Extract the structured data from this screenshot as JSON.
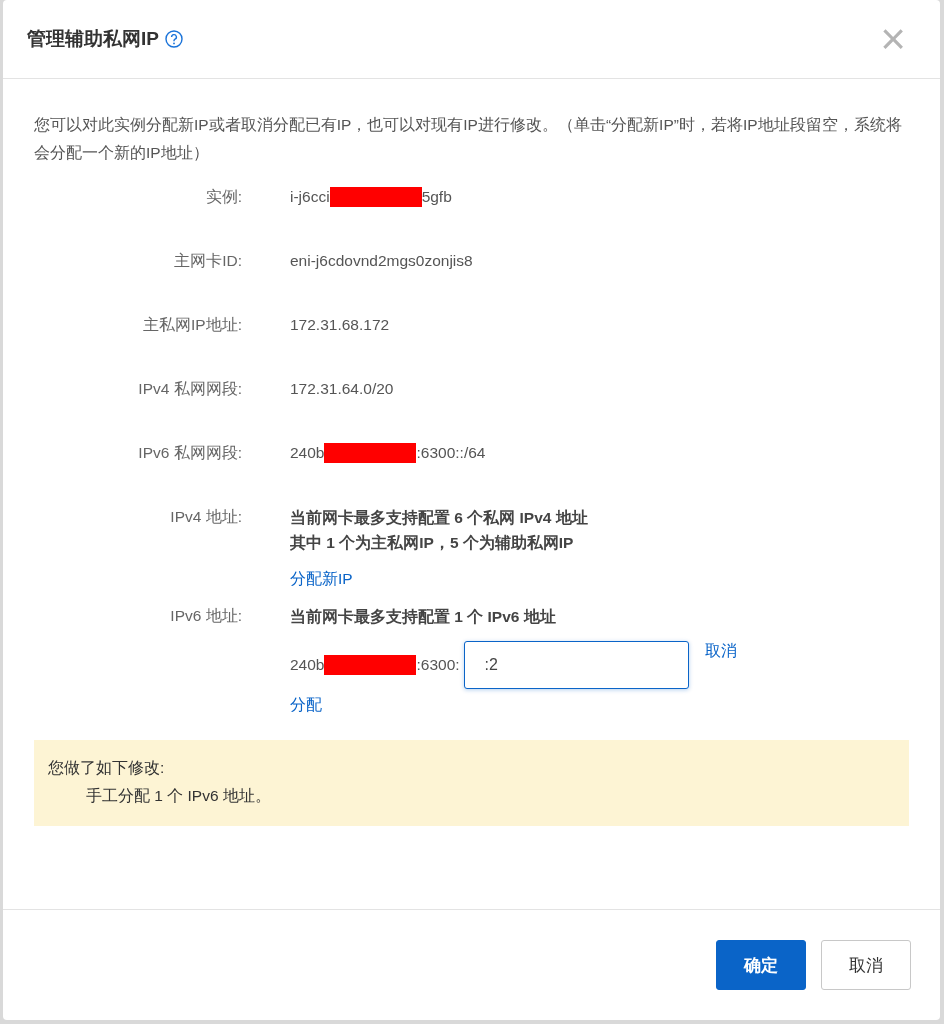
{
  "dialog": {
    "title": "管理辅助私网IP",
    "close": "×"
  },
  "intro": "您可以对此实例分配新IP或者取消分配已有IP，也可以对现有IP进行修改。（单击“分配新IP”时，若将IP地址段留空，系统将会分配一个新的IP地址）",
  "fields": [
    {
      "kind": "plain",
      "label": "实例:",
      "segments": [
        {
          "kind": "text",
          "text": "i-j6cci"
        },
        {
          "kind": "redacted"
        },
        {
          "kind": "text",
          "text": "5gfb"
        }
      ]
    },
    {
      "kind": "plain",
      "label": "主网卡ID:",
      "segments": [
        {
          "kind": "text",
          "text": "eni-j6cdovnd2mgs0zonjis8"
        }
      ]
    },
    {
      "kind": "plain",
      "label": "主私网IP地址:",
      "segments": [
        {
          "kind": "text",
          "text": "172.31.68.172"
        }
      ]
    },
    {
      "kind": "plain",
      "label": "IPv4 私网网段:",
      "segments": [
        {
          "kind": "text",
          "text": "172.31.64.0/20"
        }
      ]
    },
    {
      "kind": "plain",
      "label": "IPv6 私网网段:",
      "segments": [
        {
          "kind": "text",
          "text": "240b"
        },
        {
          "kind": "redacted"
        },
        {
          "kind": "text",
          "text": ":6300::/64"
        }
      ]
    },
    {
      "kind": "info",
      "label": "IPv4 地址:",
      "lines": [
        "当前网卡最多支持配置 6 个私网 IPv4 地址",
        "其中 1 个为主私网IP，5 个为辅助私网IP"
      ],
      "link": "分配新IP"
    },
    {
      "kind": "entry",
      "label": "IPv6 地址:",
      "lines": [
        "当前网卡最多支持配置 1 个 IPv6 地址"
      ],
      "segments": [
        {
          "kind": "text",
          "text": "240b"
        },
        {
          "kind": "redacted"
        },
        {
          "kind": "text",
          "text": ":6300:"
        }
      ],
      "input": {
        "value": ":2",
        "focused": true
      },
      "cancel": "取消",
      "link": "分配"
    }
  ],
  "notice": {
    "title": "您做了如下修改:",
    "items": [
      "手工分配 1 个 IPv6 地址。"
    ]
  },
  "buttons": [
    {
      "label": "确定",
      "primary": true
    },
    {
      "label": "取消",
      "primary": false
    }
  ]
}
